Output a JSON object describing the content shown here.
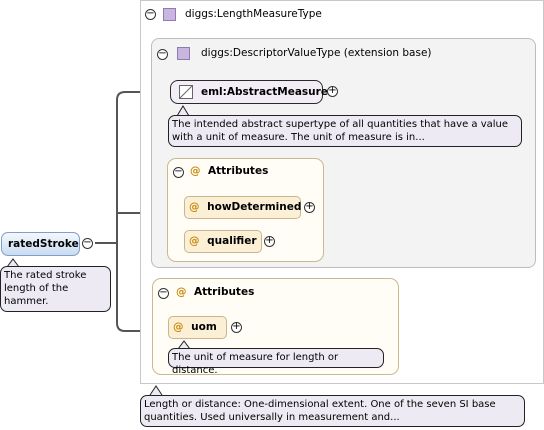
{
  "root_element": {
    "name": "ratedStroke",
    "documentation": [
      "The rated stroke",
      "length of the",
      "hammer."
    ]
  },
  "type": {
    "name": "diggs:LengthMeasureType",
    "documentation": [
      "Length or distance: One-dimensional extent. One of the seven SI base",
      "quantities. Used universally in measurement and..."
    ]
  },
  "base_type": {
    "name": "diggs:DescriptorValueType (extension base)"
  },
  "abstract_element": {
    "name": "eml:AbstractMeasure",
    "documentation": [
      "The intended abstract supertype of all quantities that have a value",
      "with a unit of measure. The unit of measure is in..."
    ]
  },
  "base_attributes": {
    "label": "Attributes",
    "items": [
      {
        "name": "howDetermined"
      },
      {
        "name": "qualifier"
      }
    ]
  },
  "type_attributes": {
    "label": "Attributes",
    "items": [
      {
        "name": "uom",
        "documentation": "The unit of measure for length or distance."
      }
    ]
  },
  "glyphs": {
    "expanded": "−",
    "collapsed": "+",
    "attribute": "@"
  },
  "colors": {
    "type_icon": "#c8b6e0",
    "element_fill": "#f2edf7",
    "attribute_fill": "#fbf0d6",
    "attribute_symbol": "#c98a10",
    "root_fill": "#c9dcf1"
  }
}
